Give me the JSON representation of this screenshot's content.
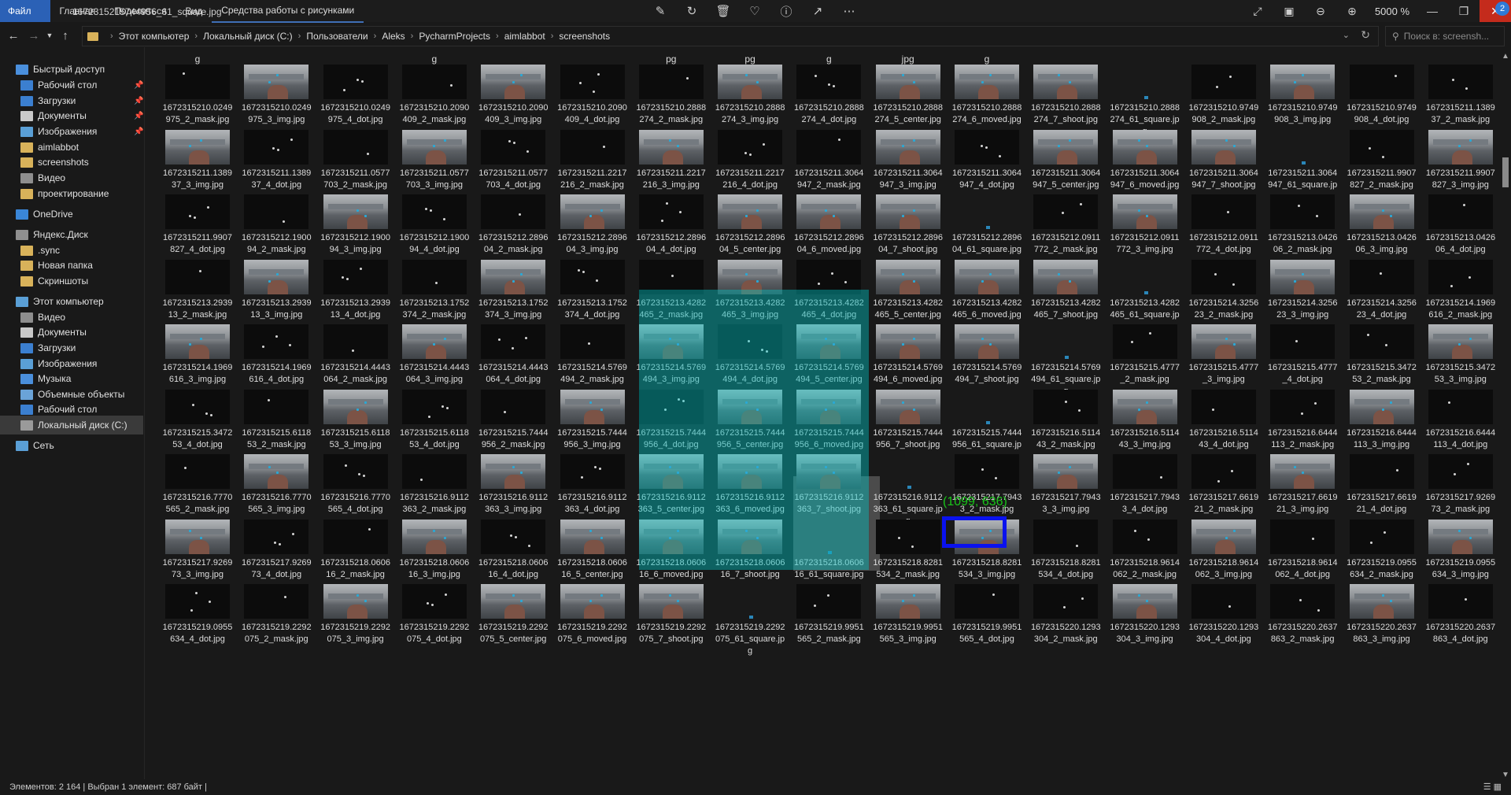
{
  "window": {
    "title": "1672315215744956_61_square.jpg"
  },
  "ribbon": {
    "tabs": [
      "Файл",
      "Главная",
      "Поделиться",
      "Вид",
      "Средства работы с рисунками"
    ]
  },
  "viewer": {
    "zoom": "5000 %",
    "notifications": "2"
  },
  "address": {
    "crumbs": [
      "Этот компьютер",
      "Локальный диск (C:)",
      "Пользователи",
      "Aleks",
      "PycharmProjects",
      "aimlabbot",
      "screenshots"
    ],
    "search_placeholder": "Поиск в: screensh..."
  },
  "nav": {
    "items": [
      {
        "label": "Быстрый доступ",
        "icon": "star-icon"
      },
      {
        "label": "Рабочий стол",
        "icon": "desktop-icon"
      },
      {
        "label": "Загрузки",
        "icon": "download-icon"
      },
      {
        "label": "Документы",
        "icon": "document-icon"
      },
      {
        "label": "Изображения",
        "icon": "pictures-icon"
      },
      {
        "label": "aimlabbot",
        "icon": "folder-icon"
      },
      {
        "label": "screenshots",
        "icon": "folder-icon"
      },
      {
        "label": "Видео",
        "icon": "video-icon"
      },
      {
        "label": "проектирование",
        "icon": "folder-icon"
      },
      {
        "label": "OneDrive",
        "icon": "cloud-icon"
      },
      {
        "label": "Яндекс.Диск",
        "icon": "yandex-disk-icon"
      },
      {
        "label": ".sync",
        "icon": "folder-icon"
      },
      {
        "label": "Новая папка",
        "icon": "folder-icon"
      },
      {
        "label": "Скриншоты",
        "icon": "folder-icon"
      },
      {
        "label": "Этот компьютер",
        "icon": "computer-icon"
      },
      {
        "label": "Видео",
        "icon": "video-icon"
      },
      {
        "label": "Документы",
        "icon": "document-icon"
      },
      {
        "label": "Загрузки",
        "icon": "download-icon"
      },
      {
        "label": "Изображения",
        "icon": "pictures-icon"
      },
      {
        "label": "Музыка",
        "icon": "music-icon"
      },
      {
        "label": "Объемные объекты",
        "icon": "3d-objects-icon"
      },
      {
        "label": "Рабочий стол",
        "icon": "desktop-icon"
      },
      {
        "label": "Локальный диск (C:)",
        "icon": "drive-icon"
      },
      {
        "label": "Сеть",
        "icon": "network-icon"
      }
    ]
  },
  "files": {
    "top_fragments": [
      "g",
      "",
      "",
      "g",
      "",
      "",
      "pg",
      "pg",
      "g",
      "jpg",
      "g",
      "",
      "",
      "",
      "",
      "",
      "",
      "",
      ""
    ],
    "rows": [
      [
        "1672315210.0249975_2_mask.jpg",
        "1672315210.0249975_3_img.jpg",
        "1672315210.0249975_4_dot.jpg",
        "1672315210.2090409_2_mask.jpg",
        "1672315210.2090409_3_img.jpg",
        "1672315210.2090409_4_dot.jpg",
        "1672315210.2888274_2_mask.jpg",
        "1672315210.2888274_3_img.jpg",
        "1672315210.2888274_4_dot.jpg",
        "1672315210.2888274_5_center.jpg",
        "1672315210.2888274_6_moved.jpg",
        "1672315210.2888274_7_shoot.jpg",
        "1672315210.2888274_61_square.jpg",
        "1672315210.9749908_2_mask.jpg",
        "1672315210.9749908_3_img.jpg",
        "1672315210.9749908_4_dot.jpg",
        "1672315211.138937_2_mask.jpg"
      ],
      [
        "1672315211.138937_3_img.jpg",
        "1672315211.138937_4_dot.jpg",
        "1672315211.0577703_2_mask.jpg",
        "1672315211.0577703_3_img.jpg",
        "1672315211.0577703_4_dot.jpg",
        "1672315211.2217216_2_mask.jpg",
        "1672315211.2217216_3_img.jpg",
        "1672315211.2217216_4_dot.jpg",
        "1672315211.3064947_2_mask.jpg",
        "1672315211.3064947_3_img.jpg",
        "1672315211.3064947_4_dot.jpg",
        "1672315211.3064947_5_center.jpg",
        "1672315211.3064947_6_moved.jpg",
        "1672315211.3064947_7_shoot.jpg",
        "1672315211.3064947_61_square.jpg",
        "1672315211.9907827_2_mask.jpg",
        "1672315211.9907827_3_img.jpg"
      ],
      [
        "1672315211.9907827_4_dot.jpg",
        "1672315212.190094_2_mask.jpg",
        "1672315212.190094_3_img.jpg",
        "1672315212.190094_4_dot.jpg",
        "1672315212.289604_2_mask.jpg",
        "1672315212.289604_3_img.jpg",
        "1672315212.289604_4_dot.jpg",
        "1672315212.289604_5_center.jpg",
        "1672315212.289604_6_moved.jpg",
        "1672315212.289604_7_shoot.jpg",
        "1672315212.289604_61_square.jpg",
        "1672315212.0911772_2_mask.jpg",
        "1672315212.0911772_3_img.jpg",
        "1672315212.0911772_4_dot.jpg",
        "1672315213.042606_2_mask.jpg",
        "1672315213.042606_3_img.jpg",
        "1672315213.042606_4_dot.jpg"
      ],
      [
        "1672315213.293913_2_mask.jpg",
        "1672315213.293913_3_img.jpg",
        "1672315213.293913_4_dot.jpg",
        "1672315213.1752374_2_mask.jpg",
        "1672315213.1752374_3_img.jpg",
        "1672315213.1752374_4_dot.jpg",
        "1672315213.4282465_2_mask.jpg",
        "1672315213.4282465_3_img.jpg",
        "1672315213.4282465_4_dot.jpg",
        "1672315213.4282465_5_center.jpg",
        "1672315213.4282465_6_moved.jpg",
        "1672315213.4282465_7_shoot.jpg",
        "1672315213.4282465_61_square.jpg",
        "1672315214.325623_2_mask.jpg",
        "1672315214.325623_3_img.jpg",
        "1672315214.325623_4_dot.jpg",
        "1672315214.1969616_2_mask.jpg"
      ],
      [
        "1672315214.1969616_3_img.jpg",
        "1672315214.1969616_4_dot.jpg",
        "1672315214.4443064_2_mask.jpg",
        "1672315214.4443064_3_img.jpg",
        "1672315214.4443064_4_dot.jpg",
        "1672315214.5769494_2_mask.jpg",
        "1672315214.5769494_3_img.jpg",
        "1672315214.5769494_4_dot.jpg",
        "1672315214.5769494_5_center.jpg",
        "1672315214.5769494_6_moved.jpg",
        "1672315214.5769494_7_shoot.jpg",
        "1672315214.5769494_61_square.jpg",
        "1672315215.4777_2_mask.jpg",
        "1672315215.4777_3_img.jpg",
        "1672315215.4777_4_dot.jpg",
        "1672315215.347253_2_mask.jpg",
        "1672315215.347253_3_img.jpg"
      ],
      [
        "1672315215.347253_4_dot.jpg",
        "1672315215.611853_2_mask.jpg",
        "1672315215.611853_3_img.jpg",
        "1672315215.611853_4_dot.jpg",
        "1672315215.7444956_2_mask.jpg",
        "1672315215.7444956_3_img.jpg",
        "1672315215.7444956_4_dot.jpg",
        "1672315215.7444956_5_center.jpg",
        "1672315215.7444956_6_moved.jpg",
        "1672315215.7444956_7_shoot.jpg",
        "1672315215.7444956_61_square.jpg",
        "1672315216.511443_2_mask.jpg",
        "1672315216.511443_3_img.jpg",
        "1672315216.511443_4_dot.jpg",
        "1672315216.6444113_2_mask.jpg",
        "1672315216.6444113_3_img.jpg",
        "1672315216.6444113_4_dot.jpg"
      ],
      [
        "1672315216.7770565_2_mask.jpg",
        "1672315216.7770565_3_img.jpg",
        "1672315216.7770565_4_dot.jpg",
        "1672315216.9112363_2_mask.jpg",
        "1672315216.9112363_3_img.jpg",
        "1672315216.9112363_4_dot.jpg",
        "1672315216.9112363_5_center.jpg",
        "1672315216.9112363_6_moved.jpg",
        "1672315216.9112363_7_shoot.jpg",
        "1672315216.9112363_61_square.jpg",
        "1672315217.79433_2_mask.jpg",
        "1672315217.79433_3_img.jpg",
        "1672315217.79433_4_dot.jpg",
        "1672315217.661921_2_mask.jpg",
        "1672315217.661921_3_img.jpg",
        "1672315217.661921_4_dot.jpg",
        "1672315217.926973_2_mask.jpg"
      ],
      [
        "1672315217.926973_3_img.jpg",
        "1672315217.926973_4_dot.jpg",
        "1672315218.060616_2_mask.jpg",
        "1672315218.060616_3_img.jpg",
        "1672315218.060616_4_dot.jpg",
        "1672315218.060616_5_center.jpg",
        "1672315218.060616_6_moved.jpg",
        "1672315218.060616_7_shoot.jpg",
        "1672315218.060616_61_square.jpg",
        "1672315218.8281534_2_mask.jpg",
        "1672315218.8281534_3_img.jpg",
        "1672315218.8281534_4_dot.jpg",
        "1672315218.9614062_2_mask.jpg",
        "1672315218.9614062_3_img.jpg",
        "1672315218.9614062_4_dot.jpg",
        "1672315219.0955634_2_mask.jpg",
        "1672315219.0955634_3_img.jpg"
      ],
      [
        "1672315219.0955634_4_dot.jpg",
        "1672315219.2292075_2_mask.jpg",
        "1672315219.2292075_3_img.jpg",
        "1672315219.2292075_4_dot.jpg",
        "1672315219.2292075_5_center.jpg",
        "1672315219.2292075_6_moved.jpg",
        "1672315219.2292075_7_shoot.jpg",
        "1672315219.2292075_61_square.jpg",
        "1672315219.9951565_2_mask.jpg",
        "1672315219.9951565_3_img.jpg",
        "1672315219.9951565_4_dot.jpg",
        "1672315220.1293304_2_mask.jpg",
        "1672315220.1293304_3_img.jpg",
        "1672315220.1293304_4_dot.jpg",
        "1672315220.2637863_2_mask.jpg",
        "1672315220.2637863_3_img.jpg",
        "1672315220.2637863_4_dot.jpg"
      ]
    ]
  },
  "overlay": {
    "coords": "(1099, 636)"
  },
  "status": {
    "text": "Элементов: 2 164  |  Выбран 1 элемент: 687 байт  |"
  }
}
